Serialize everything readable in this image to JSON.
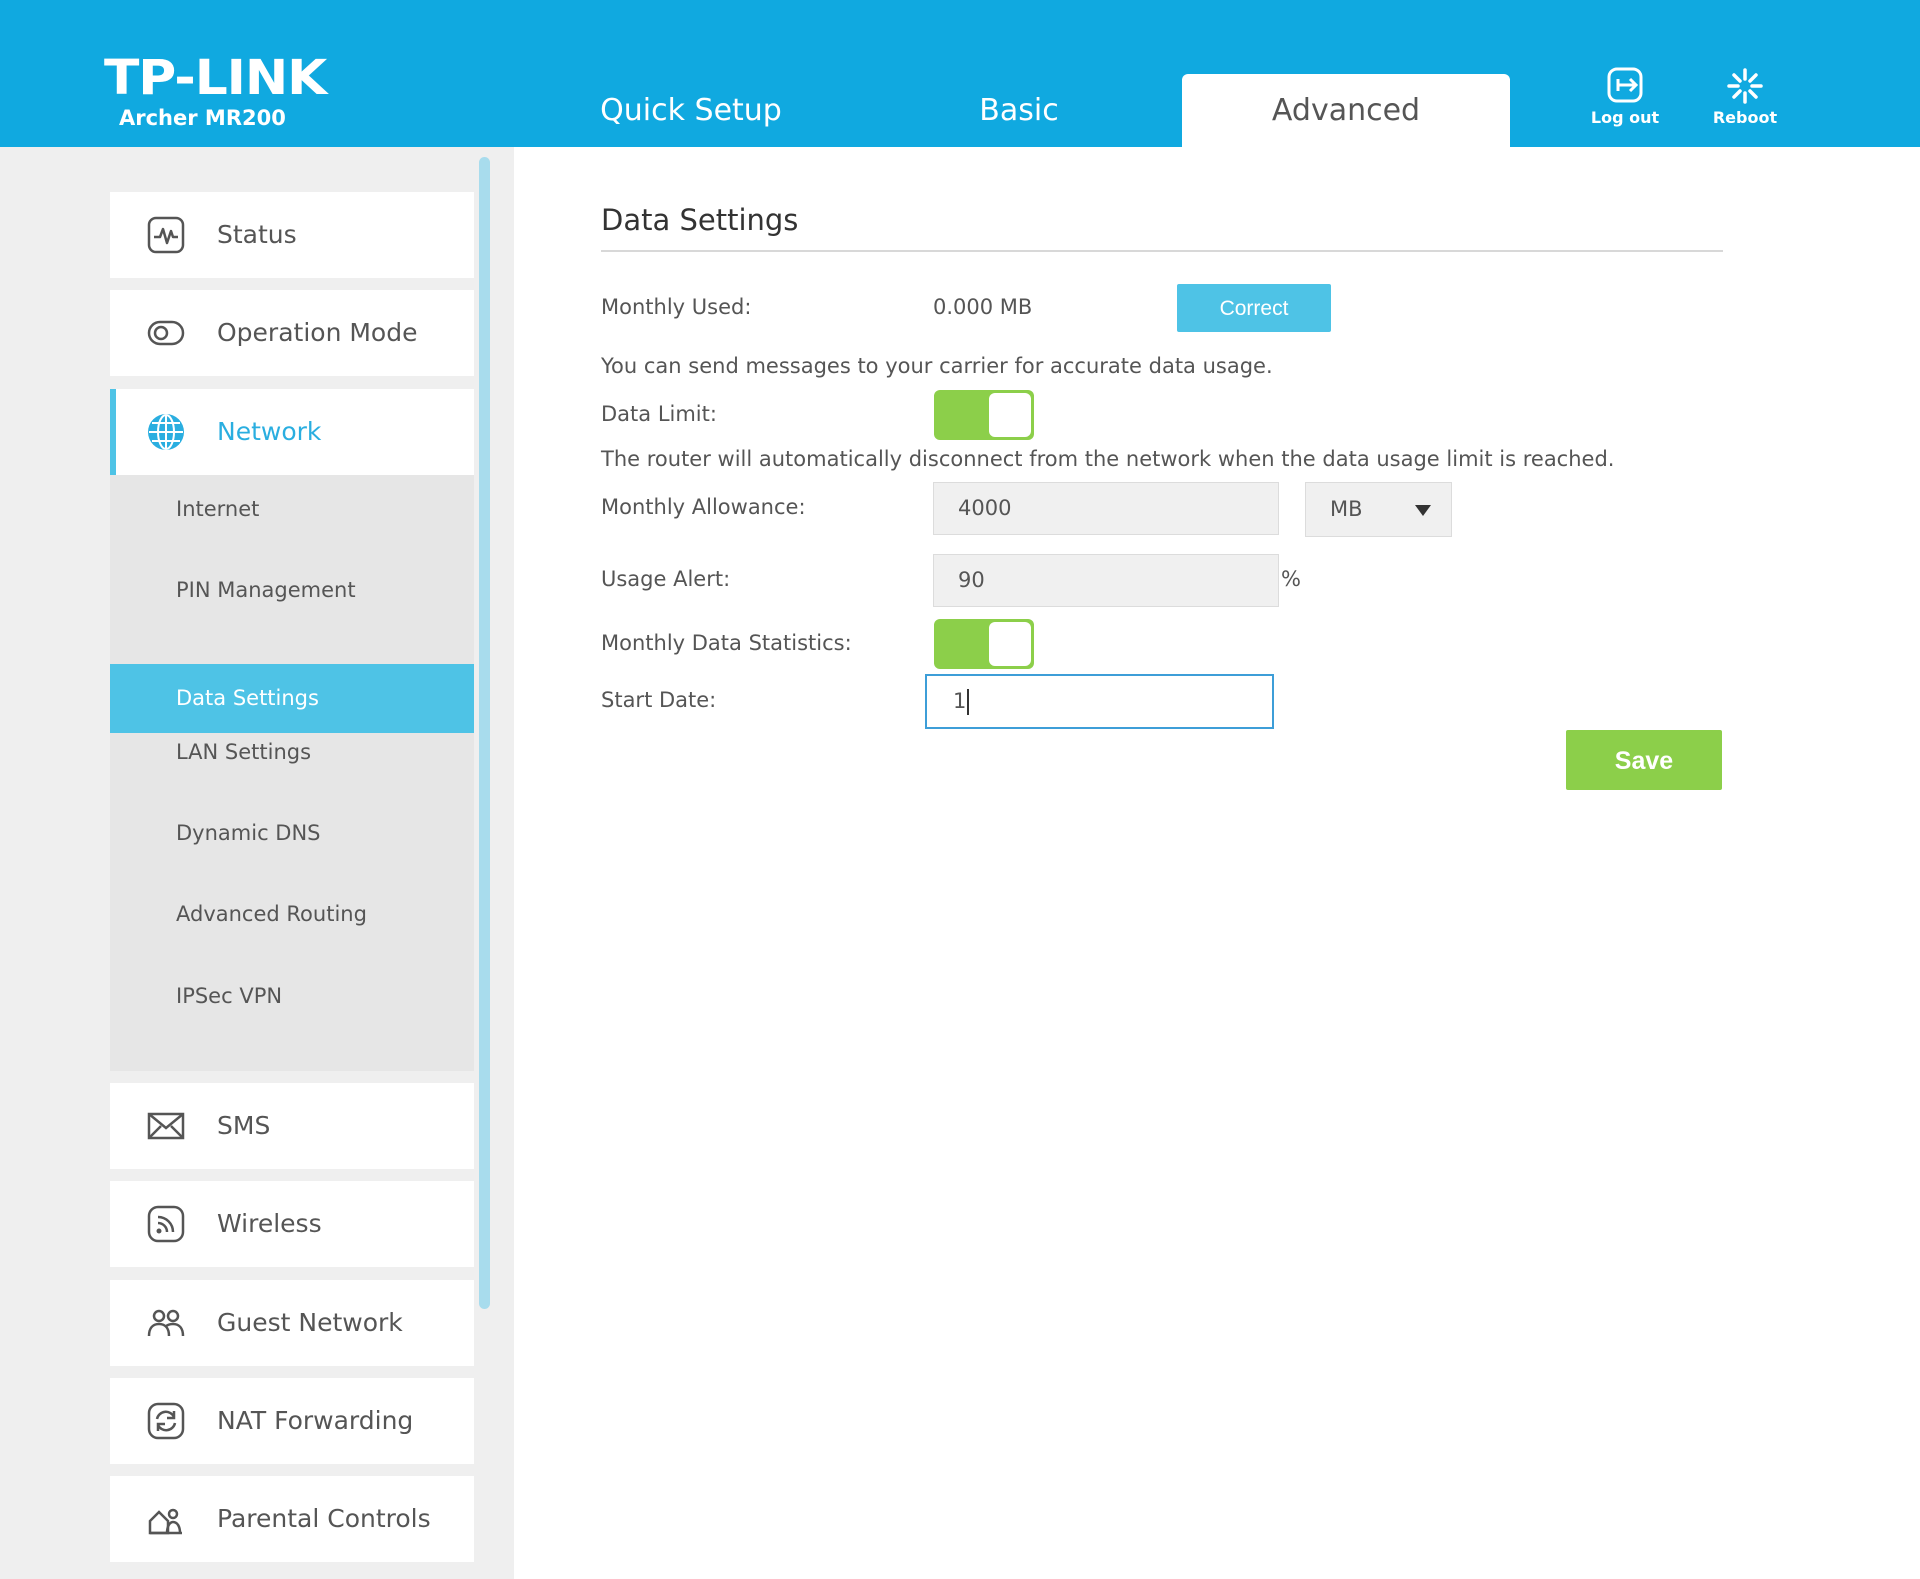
{
  "header": {
    "brand": "TP-LINK",
    "model": "Archer MR200",
    "tabs": [
      {
        "label": "Quick Setup",
        "active": false
      },
      {
        "label": "Basic",
        "active": false
      },
      {
        "label": "Advanced",
        "active": true
      }
    ],
    "logout_label": "Log out",
    "reboot_label": "Reboot"
  },
  "sidebar": {
    "top_items": [
      {
        "label": "Status",
        "icon": "status-icon"
      },
      {
        "label": "Operation Mode",
        "icon": "operation-mode-icon"
      },
      {
        "label": "Network",
        "icon": "globe-icon",
        "active": true
      }
    ],
    "network_subitems": [
      {
        "label": "Internet"
      },
      {
        "label": "PIN Management"
      },
      {
        "label": "Data Settings",
        "active": true
      },
      {
        "label": "LAN Settings"
      },
      {
        "label": "Dynamic DNS"
      },
      {
        "label": "Advanced Routing"
      },
      {
        "label": "IPSec VPN"
      }
    ],
    "bottom_items": [
      {
        "label": "SMS",
        "icon": "envelope-icon"
      },
      {
        "label": "Wireless",
        "icon": "wireless-icon"
      },
      {
        "label": "Guest Network",
        "icon": "guest-network-icon"
      },
      {
        "label": "NAT Forwarding",
        "icon": "nat-forwarding-icon"
      },
      {
        "label": "Parental Controls",
        "icon": "parental-controls-icon"
      }
    ]
  },
  "main": {
    "title": "Data Settings",
    "monthly_used_label": "Monthly Used:",
    "monthly_used_value": "0.000 MB",
    "correct_label": "Correct",
    "carrier_note": "You can send messages to your carrier for accurate data usage.",
    "data_limit_label": "Data Limit:",
    "data_limit_on": true,
    "disconnect_note": "The router will automatically disconnect from the network when the data usage limit is reached.",
    "monthly_allowance_label": "Monthly Allowance:",
    "monthly_allowance_value": "4000",
    "allowance_unit": "MB",
    "usage_alert_label": "Usage Alert:",
    "usage_alert_value": "90",
    "usage_alert_unit": "%",
    "monthly_stats_label": "Monthly Data Statistics:",
    "monthly_stats_on": true,
    "start_date_label": "Start Date:",
    "start_date_value": "1",
    "save_label": "Save"
  },
  "colors": {
    "header_blue": "#10a9e0",
    "accent_blue": "#4ec3e6",
    "toggle_green": "#8ccf4a",
    "focus_border": "#3d9ed8"
  }
}
